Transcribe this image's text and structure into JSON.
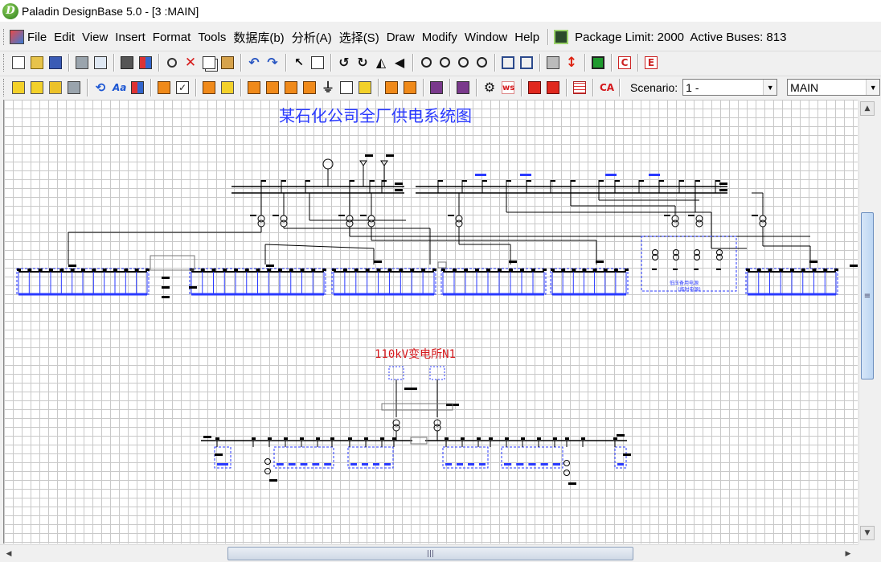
{
  "window": {
    "title": "Paladin DesignBase 5.0 - [3 :MAIN]",
    "logo_glyph": "D"
  },
  "menubar": {
    "items": [
      "File",
      "Edit",
      "View",
      "Insert",
      "Format",
      "Tools",
      "数据库(b)",
      "分析(A)",
      "选择(S)",
      "Draw",
      "Modify",
      "Window",
      "Help"
    ],
    "package_limit": "Package Limit: 2000",
    "active_buses": "Active Buses: 813"
  },
  "toolbar2": {
    "scenario_label": "Scenario:",
    "scenario_value": "1 -",
    "view_value": "MAIN",
    "ws_label": "ws",
    "ca_label": "CA"
  },
  "toolbar1": {
    "c_label": "C",
    "e_label": "E"
  },
  "canvas": {
    "diagram_title": "某石化公司全厂供电系统图",
    "substation_label": "110kV变电所N1",
    "mini_label_1": "低压备用电源",
    "mini_label_2": "(临时电源)"
  },
  "colors": {
    "bus_blue": "#2a3aff",
    "label_red": "#d4161a",
    "grid": "#c9c9c9"
  }
}
